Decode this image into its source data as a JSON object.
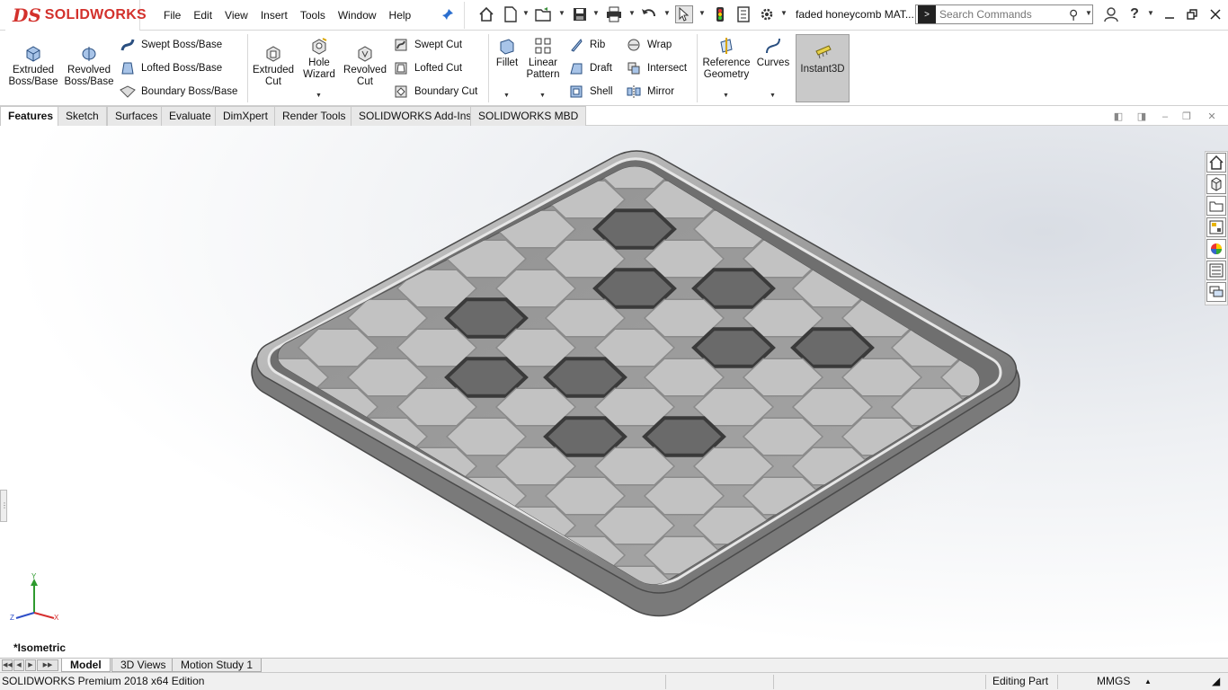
{
  "app": {
    "brand_prefix": "DS",
    "brand_name": "SOLIDWORKS"
  },
  "menu": [
    "File",
    "Edit",
    "View",
    "Insert",
    "Tools",
    "Window",
    "Help"
  ],
  "document_title": "faded honeycomb MAT...",
  "search": {
    "placeholder": "Search Commands"
  },
  "ribbon": {
    "extruded_boss": "Extruded\nBoss/Base",
    "revolved_boss": "Revolved\nBoss/Base",
    "swept_boss": "Swept Boss/Base",
    "lofted_boss": "Lofted Boss/Base",
    "boundary_boss": "Boundary Boss/Base",
    "extruded_cut": "Extruded\nCut",
    "hole_wizard": "Hole\nWizard",
    "revolved_cut": "Revolved\nCut",
    "swept_cut": "Swept Cut",
    "lofted_cut": "Lofted Cut",
    "boundary_cut": "Boundary Cut",
    "fillet": "Fillet",
    "linear_pattern": "Linear\nPattern",
    "rib": "Rib",
    "draft": "Draft",
    "shell": "Shell",
    "wrap": "Wrap",
    "intersect": "Intersect",
    "mirror": "Mirror",
    "reference_geometry": "Reference\nGeometry",
    "curves": "Curves",
    "instant3d": "Instant3D"
  },
  "command_tabs": [
    "Features",
    "Sketch",
    "Surfaces",
    "Evaluate",
    "DimXpert",
    "Render Tools",
    "SOLIDWORKS Add-Ins",
    "SOLIDWORKS MBD"
  ],
  "active_command_tab": "Features",
  "view_orientation": "*Isometric",
  "triad": {
    "x": "X",
    "y": "Y",
    "z": "Z"
  },
  "bottom_tabs": [
    "Model",
    "3D Views",
    "Motion Study 1"
  ],
  "status": {
    "edition": "SOLIDWORKS Premium 2018 x64 Edition",
    "mode": "Editing Part",
    "units": "MMGS"
  },
  "colors": {
    "brand_red": "#d3312c",
    "instant3d_active": "#c9c9c9"
  }
}
